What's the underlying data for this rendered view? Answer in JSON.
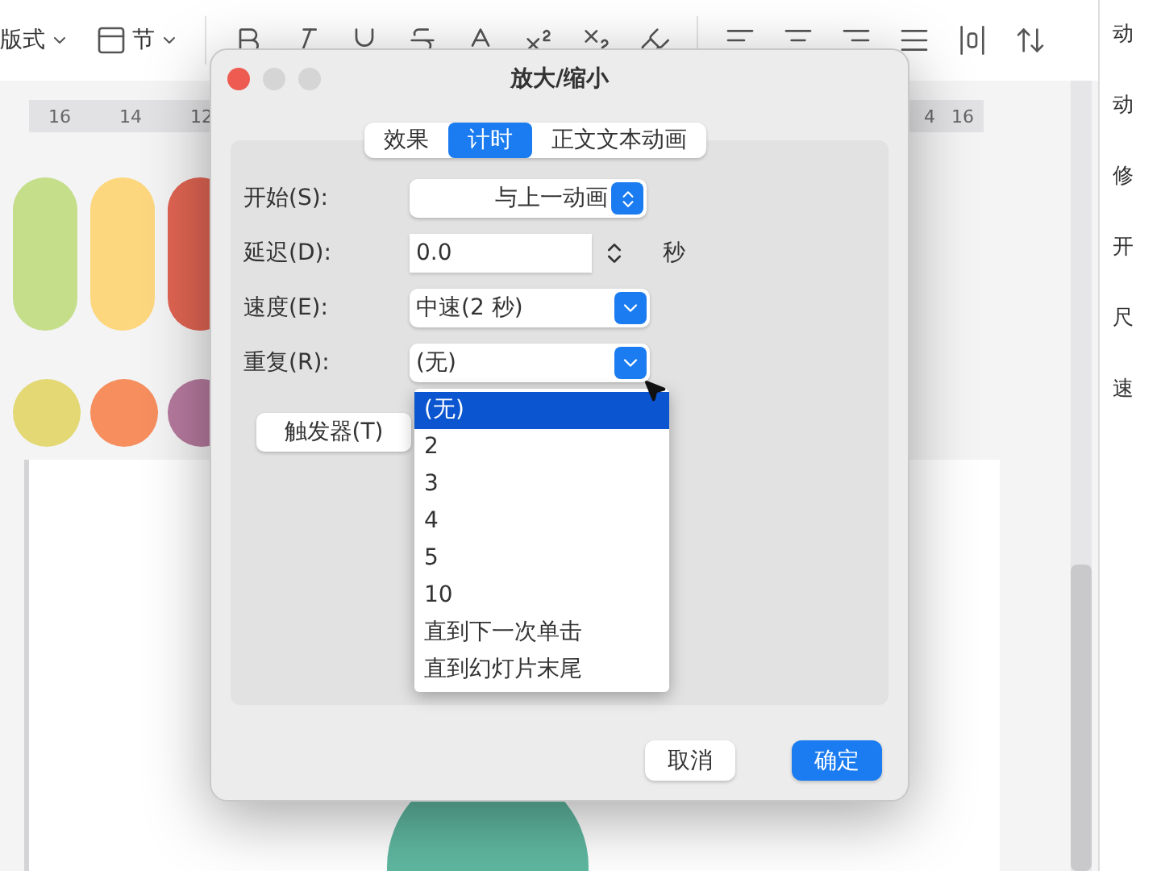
{
  "toolbar": {
    "layout_menu": "版式",
    "section_menu": "节"
  },
  "ruler": {
    "left_ticks": [
      "16",
      "14",
      "12"
    ],
    "right_ticks": [
      "4",
      "16"
    ]
  },
  "right_panel": {
    "items": [
      "动",
      "动",
      "修",
      "开",
      "尺",
      "速"
    ]
  },
  "dialog": {
    "title": "放大/缩小",
    "tabs": [
      {
        "label": "效果",
        "selected": false
      },
      {
        "label": "计时",
        "selected": true
      },
      {
        "label": "正文文本动画",
        "selected": false
      }
    ],
    "fields": [
      {
        "kind": "popup",
        "label": "开始(S):",
        "value": "与上一动画"
      },
      {
        "kind": "stepper",
        "label": "延迟(D):",
        "value": "0.0",
        "unit": "秒"
      },
      {
        "kind": "select",
        "label": "速度(E):",
        "value": "中速(2 秒)"
      },
      {
        "kind": "select",
        "label": "重复(R):",
        "value": "(无)"
      }
    ],
    "trigger_button": "触发器(T)",
    "dropdown": {
      "options": [
        {
          "label": "(无)",
          "selected": true
        },
        {
          "label": "2",
          "selected": false
        },
        {
          "label": "3",
          "selected": false
        },
        {
          "label": "4",
          "selected": false
        },
        {
          "label": "5",
          "selected": false
        },
        {
          "label": "10",
          "selected": false
        },
        {
          "label": "直到下一次单击",
          "selected": false
        },
        {
          "label": "直到幻灯片末尾",
          "selected": false
        }
      ]
    },
    "buttons": [
      {
        "label": "取消",
        "primary": false
      },
      {
        "label": "确定",
        "primary": true
      }
    ]
  }
}
